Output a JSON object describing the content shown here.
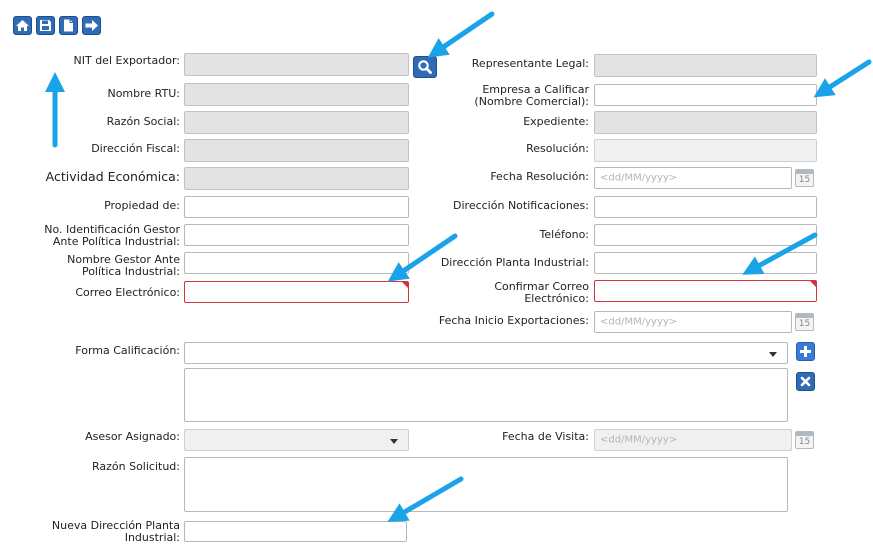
{
  "toolbar": {
    "icons": [
      "home-icon",
      "save-icon",
      "document-icon",
      "arrow-right-icon"
    ]
  },
  "form": {
    "nit_exportador": "NIT del Exportador:",
    "nombre_rtu": "Nombre RTU:",
    "razon_social": "Razón Social:",
    "direccion_fiscal": "Dirección Fiscal:",
    "actividad_economica": "Actividad Económica:",
    "propiedad_de": "Propiedad de:",
    "no_identificacion_1": "No. Identificación Gestor",
    "no_identificacion_2": "Ante Política Industrial:",
    "nombre_gestor_1": "Nombre Gestor Ante",
    "nombre_gestor_2": "Política Industrial:",
    "correo_electronico": "Correo Electrónico:",
    "representante_legal": "Representante Legal:",
    "empresa_calificar_1": "Empresa a Calificar",
    "empresa_calificar_2": "(Nombre Comercial):",
    "expediente": "Expediente:",
    "resolucion": "Resolución:",
    "fecha_resolucion": "Fecha Resolución:",
    "direccion_notificaciones": "Dirección Notificaciones:",
    "telefono": "Teléfono:",
    "direccion_planta": "Dirección Planta Industrial:",
    "confirmar_correo_1": "Confirmar Correo",
    "confirmar_correo_2": "Electrónico:",
    "fecha_inicio_exportaciones": "Fecha Inicio Exportaciones:",
    "forma_calificacion": "Forma Calificación:",
    "asesor_asignado": "Asesor Asignado:",
    "fecha_visita": "Fecha de Visita:",
    "razon_solicitud": "Razón Solicitud:",
    "nueva_direccion_1": "Nueva Dirección Planta",
    "nueva_direccion_2": "Industrial:",
    "date_placeholder": "<dd/MM/yyyy>",
    "calendar_day": "15"
  },
  "colors": {
    "button_blue": "#2f6bb7",
    "arrow_blue": "#1aa3e8",
    "error_red": "#d0363f",
    "add_button": "#3a7bd5",
    "remove_button": "#2f6bb7"
  }
}
